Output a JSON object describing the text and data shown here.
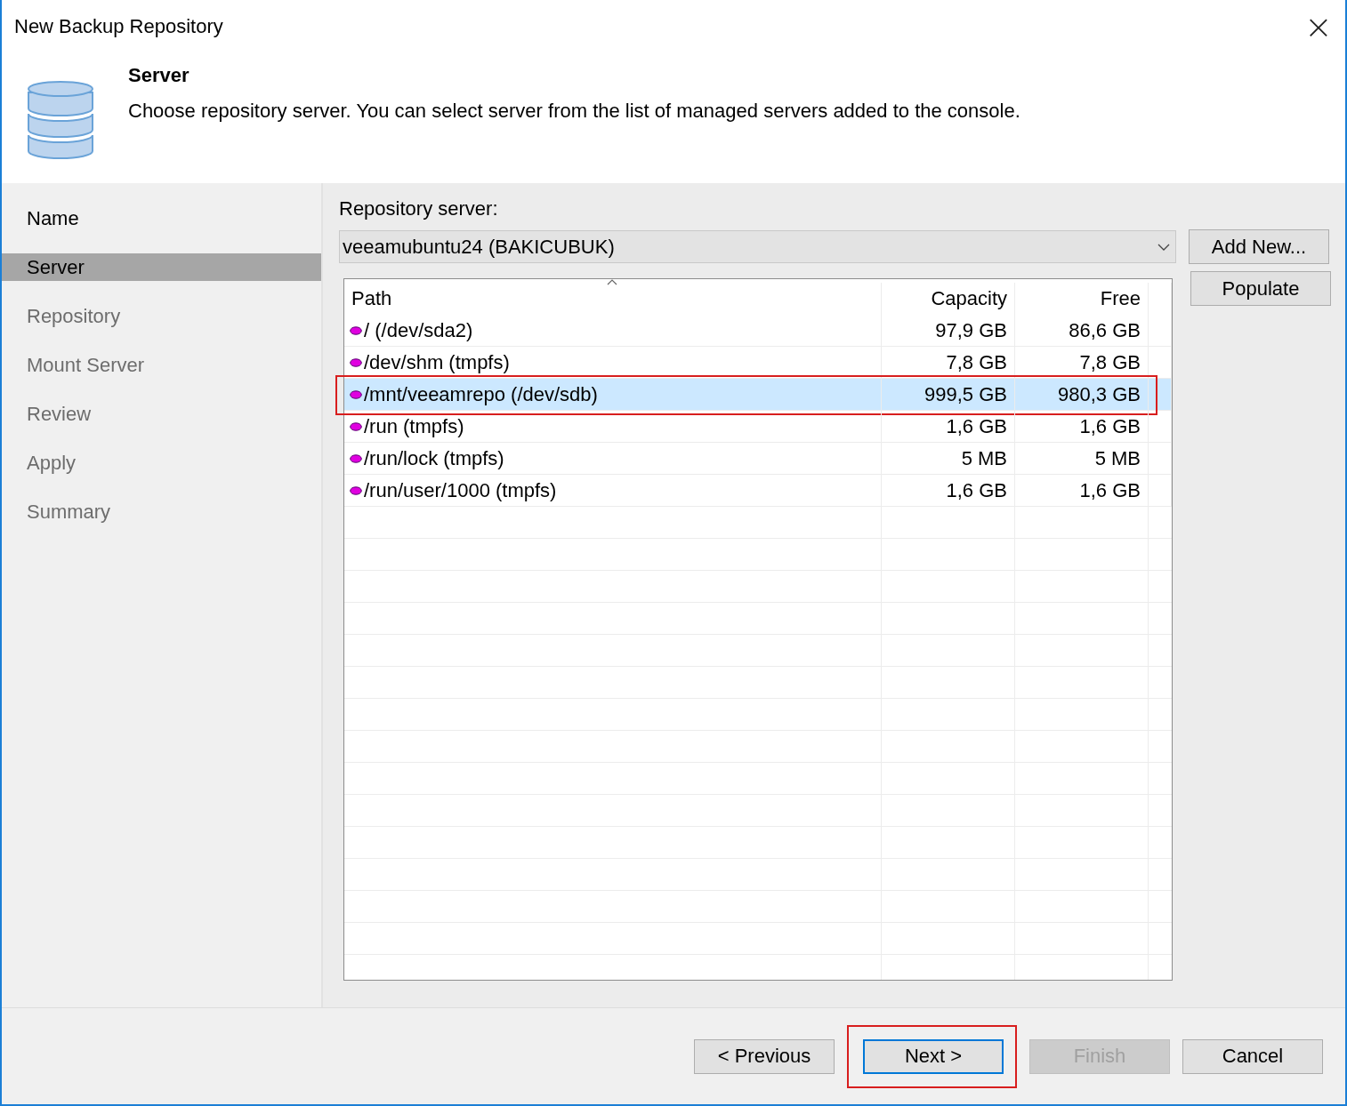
{
  "window": {
    "title": "New Backup Repository",
    "close": "×"
  },
  "header": {
    "title": "Server",
    "description": "Choose repository server. You can select server from the list of managed servers added to the console."
  },
  "sidebar": {
    "items": [
      {
        "label": "Name",
        "selected": false,
        "disabled": false
      },
      {
        "label": "Server",
        "selected": true,
        "disabled": false
      },
      {
        "label": "Repository",
        "selected": false,
        "disabled": true
      },
      {
        "label": "Mount Server",
        "selected": false,
        "disabled": true
      },
      {
        "label": "Review",
        "selected": false,
        "disabled": true
      },
      {
        "label": "Apply",
        "selected": false,
        "disabled": true
      },
      {
        "label": "Summary",
        "selected": false,
        "disabled": true
      }
    ]
  },
  "server": {
    "label": "Repository server:",
    "value": "veeamubuntu24 (BAKICUBUK)",
    "buttons": [
      {
        "label": "Add New..."
      },
      {
        "label": "Populate"
      }
    ]
  },
  "table": {
    "columns": [
      "Path",
      "Capacity",
      "Free"
    ],
    "rows": [
      {
        "path": "/ (/dev/sda2)",
        "capacity": "97,9 GB",
        "free": "86,6 GB",
        "selected": false,
        "highlighted": false
      },
      {
        "path": "/dev/shm (tmpfs)",
        "capacity": "7,8 GB",
        "free": "7,8 GB",
        "selected": false,
        "highlighted": false
      },
      {
        "path": "/mnt/veeamrepo (/dev/sdb)",
        "capacity": "999,5 GB",
        "free": "980,3 GB",
        "selected": true,
        "highlighted": true
      },
      {
        "path": "/run (tmpfs)",
        "capacity": "1,6 GB",
        "free": "1,6 GB",
        "selected": false,
        "highlighted": false
      },
      {
        "path": "/run/lock (tmpfs)",
        "capacity": "5 MB",
        "free": "5 MB",
        "selected": false,
        "highlighted": false
      },
      {
        "path": "/run/user/1000 (tmpfs)",
        "capacity": "1,6 GB",
        "free": "1,6 GB",
        "selected": false,
        "highlighted": false
      }
    ]
  },
  "footer": {
    "buttons": [
      {
        "label": "< Previous",
        "disabled": false,
        "default": false,
        "highlighted": false
      },
      {
        "label": "Next >",
        "disabled": false,
        "default": true,
        "highlighted": true
      },
      {
        "label": "Finish",
        "disabled": true,
        "default": false,
        "highlighted": false
      },
      {
        "label": "Cancel",
        "disabled": false,
        "default": false,
        "highlighted": false
      }
    ]
  }
}
